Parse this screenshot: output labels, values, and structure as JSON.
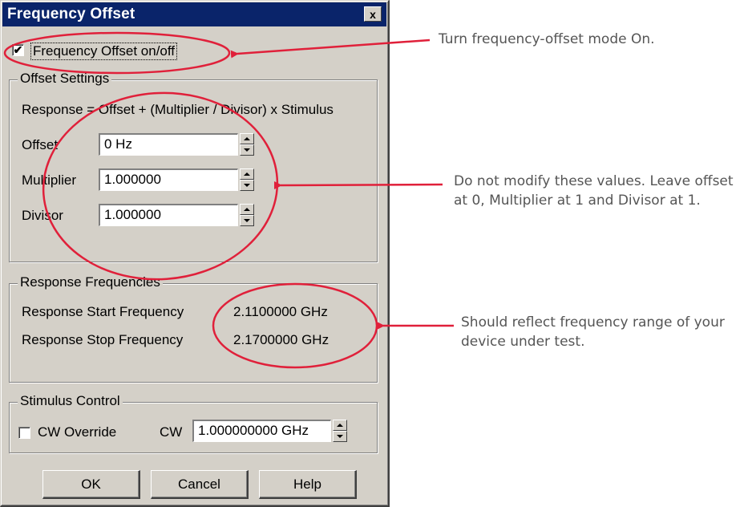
{
  "dialog": {
    "title": "Frequency Offset",
    "close_label": "x",
    "freq_offset_checkbox": {
      "checked": true,
      "mark": "✔",
      "label": "Frequency Offset on/off"
    },
    "offset_settings": {
      "title": "Offset Settings",
      "formula": "Response  =  Offset + (Multiplier / Divisor) x Stimulus",
      "offset_label": "Offset",
      "offset_value": "0 Hz",
      "multiplier_label": "Multiplier",
      "multiplier_value": "1.000000",
      "divisor_label": "Divisor",
      "divisor_value": "1.000000"
    },
    "response_frequencies": {
      "title": "Response Frequencies",
      "start_label": "Response Start Frequency",
      "start_value": "2.1100000 GHz",
      "stop_label": "Response Stop Frequency",
      "stop_value": "2.1700000 GHz"
    },
    "stimulus_control": {
      "title": "Stimulus Control",
      "cw_override_label": "CW Override",
      "cw_override_checked": false,
      "cw_label": "CW",
      "cw_value": "1.000000000 GHz"
    },
    "buttons": {
      "ok": "OK",
      "cancel": "Cancel",
      "help": "Help"
    }
  },
  "annotations": {
    "note_1": "Turn frequency-offset mode On.",
    "note_2": "Do not modify these values. Leave offset at 0, Multiplier at 1 and Divisor at 1.",
    "note_3": "Should reflect frequency range of your device under test.",
    "highlight_color": "#e0203a",
    "text_color": "#555555"
  }
}
